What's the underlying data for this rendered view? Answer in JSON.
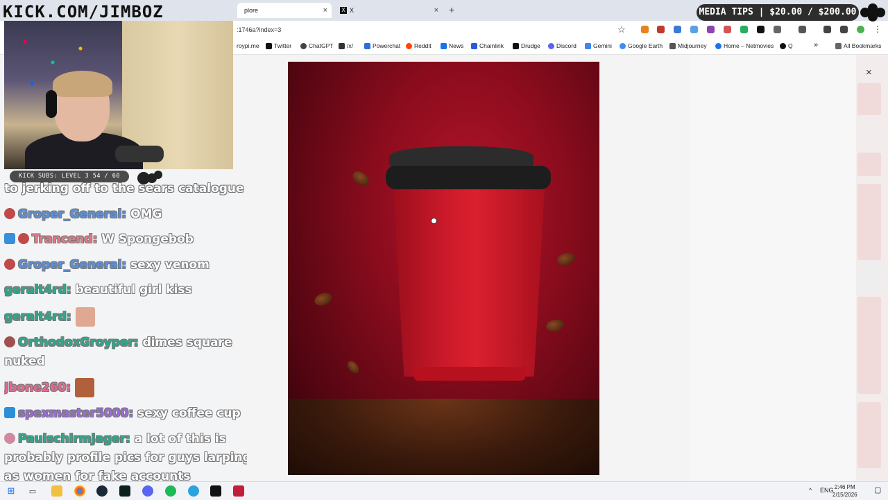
{
  "browser": {
    "tabs": [
      {
        "label": "plore",
        "close": "×"
      },
      {
        "label": "X",
        "close": "×"
      }
    ],
    "new_tab": "+",
    "url": ":1746a?index=3",
    "star": "☆",
    "bookmarks": [
      "roypi.me",
      "Twitter",
      "ChatGPT",
      "/x/",
      "Powerchat",
      "Reddit",
      "News",
      "Chainlink",
      "Drudge",
      "Discord",
      "Gemini",
      "Google Earth",
      "Midjourney",
      "Home – Netmovies",
      "Q",
      "All Bookmarks"
    ],
    "bookmarks_overflow": "»"
  },
  "modal": {
    "close": "×"
  },
  "stream": {
    "brand": "KICK.COM/JIMBOZ",
    "subs_bar": "KICK SUBS: LEVEL 3 54 / 60",
    "media_tips": "MEDIA TIPS | $20.00 / $200.00"
  },
  "chat": [
    {
      "user": "",
      "text": "to jerking off to the sears catalogue",
      "user_color": "#ffffff"
    },
    {
      "user": "Groper_General:",
      "text": "OMG",
      "user_color": "#5b8fd8"
    },
    {
      "user": "Trancend:",
      "text": "W Spongebob",
      "user_color": "#e47a86"
    },
    {
      "user": "Groper_General:",
      "text": "sexy venom",
      "user_color": "#5b8fd8"
    },
    {
      "user": "geralt4rd:",
      "text": "beautiful girl kiss",
      "user_color": "#2fa88a"
    },
    {
      "user": "geralt4rd:",
      "text": "",
      "user_color": "#2fa88a"
    },
    {
      "user": "OrthodoxGroyper:",
      "text": "dimes square",
      "user_color": "#2fa88a"
    },
    {
      "user": "",
      "text": "nuked",
      "user_color": "#ffffff"
    },
    {
      "user": "Jbone260:",
      "text": "",
      "user_color": "#e46a92"
    },
    {
      "user": "spexmaster5000:",
      "text": "sexy coffee cup",
      "user_color": "#9b6cd8"
    },
    {
      "user": "Paulschirmjager:",
      "text": "a lot of this is",
      "user_color": "#2fa88a"
    },
    {
      "user": "",
      "text": "probably profile pics for guys larping",
      "user_color": "#ffffff"
    },
    {
      "user": "",
      "text": "as women for fake accounts",
      "user_color": "#ffffff"
    }
  ],
  "taskbar": {
    "language": "ENG",
    "time": "2:46 PM",
    "date": "2/15/2026"
  }
}
